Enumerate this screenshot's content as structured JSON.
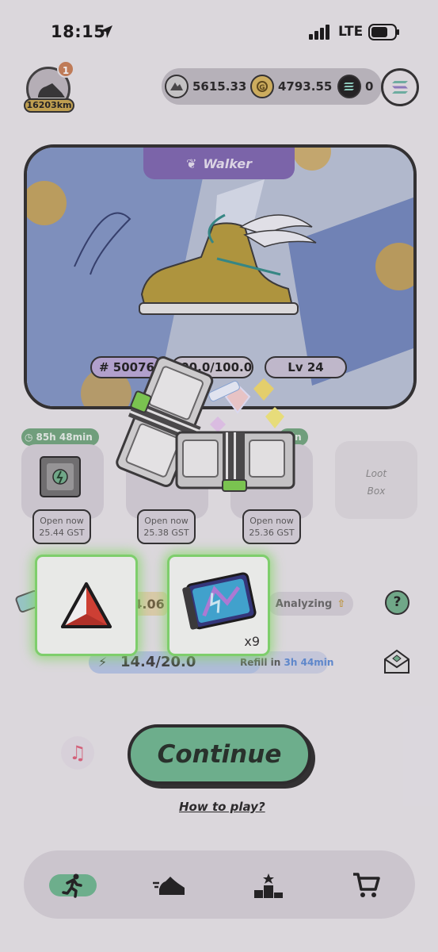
{
  "status_bar": {
    "time": "18:15",
    "network": "LTE"
  },
  "header": {
    "avatar_badge": "1",
    "distance": "16203km",
    "currencies": [
      {
        "name": "GST",
        "icon": "gst-coin-icon",
        "value": "5615.33"
      },
      {
        "name": "GMT",
        "icon": "gmt-coin-icon",
        "value": "4793.55"
      },
      {
        "name": "SOL",
        "icon": "sol-coin-icon",
        "value": "0"
      }
    ],
    "wallet_icon": "solana-wallet-icon"
  },
  "sneaker": {
    "class_label": "Walker",
    "id": "# 50076",
    "durability": "100.0/100.0",
    "level": "Lv 24"
  },
  "mystery_boxes": [
    {
      "timer": "85h 48min",
      "open_label": "Open now",
      "cost": "25.44 GST"
    },
    {
      "timer": "",
      "open_label": "Open now",
      "cost": "25.38 GST"
    },
    {
      "timer": "…in",
      "open_label": "Open now",
      "cost": "25.36 GST"
    }
  ],
  "loot_box": {
    "label_line1": "Loot",
    "label_line2": "Box"
  },
  "stats": {
    "value": "4.06",
    "analyzing_label": "Analyzing",
    "energy": "14.4/20.0",
    "energy_fraction": 0.72,
    "refill_label": "Refill in",
    "refill_time": "3h 44min"
  },
  "rewards": [
    {
      "icon": "red-gem-icon",
      "quantity": ""
    },
    {
      "icon": "sneaker-scroll-icon",
      "quantity": "x9"
    }
  ],
  "actions": {
    "continue_label": "Continue",
    "how_to_play": "How to play?"
  },
  "bottom_nav": [
    {
      "name": "run",
      "icon": "runner-icon",
      "active": true
    },
    {
      "name": "sneakers",
      "icon": "sneaker-icon",
      "active": false
    },
    {
      "name": "leaderboard",
      "icon": "podium-icon",
      "active": false
    },
    {
      "name": "market",
      "icon": "cart-icon",
      "active": false
    }
  ],
  "colors": {
    "accent_green": "#6bb88f",
    "class_purple": "#7b63b0",
    "reward_glow": "#7fdc6a",
    "gem_red": "#d93a2b"
  }
}
